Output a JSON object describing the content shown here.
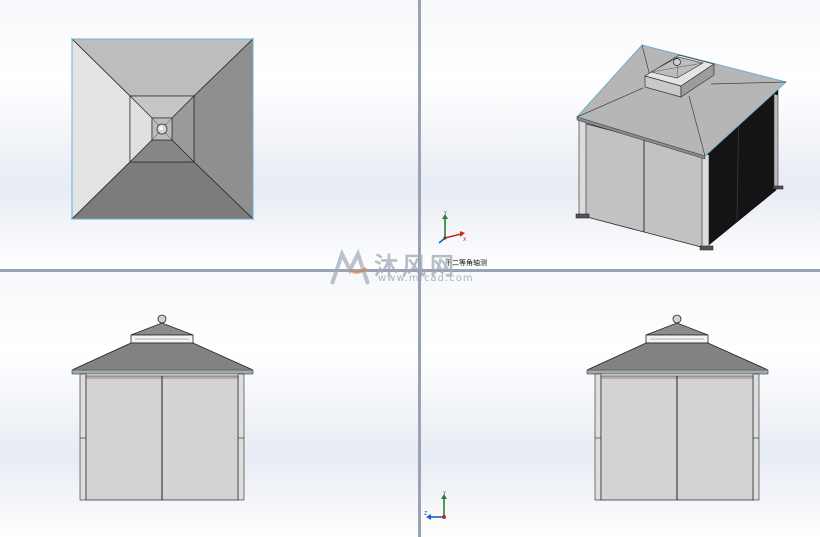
{
  "toolbar": {
    "buttons": [
      {
        "icon": "zoom-to-fit-icon"
      },
      {
        "icon": "zoom-to-area-icon"
      },
      {
        "icon": "previous-view-icon"
      },
      {
        "icon": "section-view-icon"
      },
      {
        "icon": "view-orientation-icon"
      },
      {
        "icon": "display-style-icon"
      },
      {
        "icon": "hide-show-items-icon"
      },
      {
        "icon": "edit-appearance-icon"
      },
      {
        "icon": "apply-scene-icon"
      },
      {
        "icon": "view-settings-icon"
      }
    ]
  },
  "viewports": {
    "top_right_label": "下二等角轴测"
  },
  "triad": {
    "x": "X",
    "y": "Y",
    "z": "Z"
  },
  "watermark": {
    "text": "沐风网",
    "url": "www.mfcad.com"
  },
  "colors": {
    "background_top": "#f7f8fb",
    "background_band": "#e7ebf3",
    "divider": "#9aa3b3",
    "roof_edge_highlight": "#6aaed6",
    "triad_x": "#c62828",
    "triad_y": "#2e7d32",
    "triad_z": "#1565c0"
  }
}
